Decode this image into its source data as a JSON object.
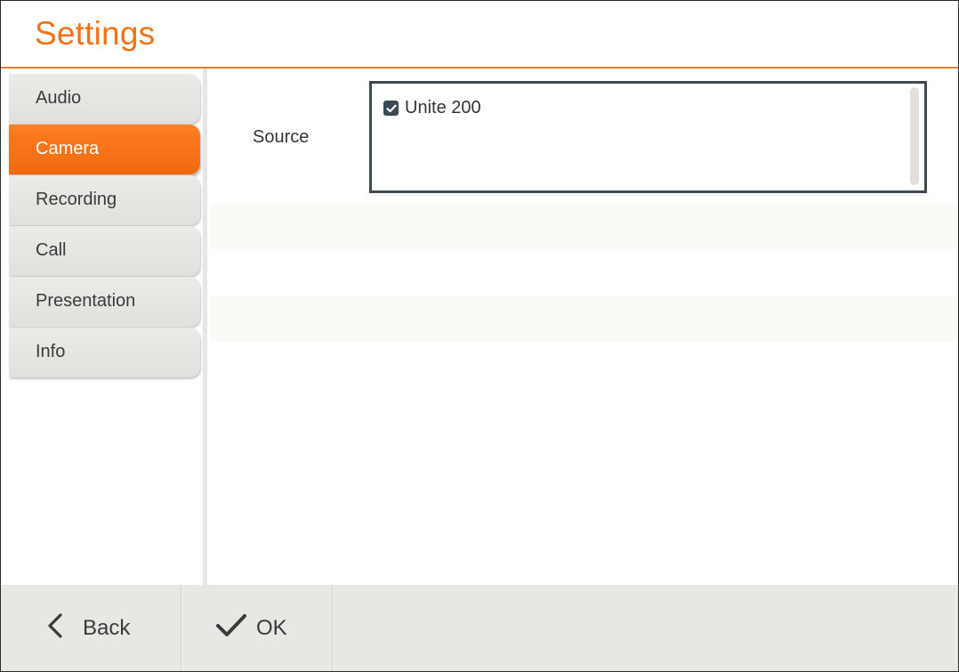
{
  "header": {
    "title": "Settings"
  },
  "sidebar": {
    "items": [
      {
        "label": "Audio",
        "active": false
      },
      {
        "label": "Camera",
        "active": true
      },
      {
        "label": "Recording",
        "active": false
      },
      {
        "label": "Call",
        "active": false
      },
      {
        "label": "Presentation",
        "active": false
      },
      {
        "label": "Info",
        "active": false
      }
    ]
  },
  "main": {
    "source": {
      "label": "Source",
      "options": [
        {
          "label": "Unite 200",
          "checked": true
        }
      ]
    }
  },
  "footer": {
    "back_label": "Back",
    "ok_label": "OK"
  },
  "colors": {
    "accent": "#f07318",
    "active_tab": "#f56f12",
    "border_dark": "#3e4b53"
  },
  "icons": {
    "back": "chevron-left-icon",
    "ok": "checkmark-icon",
    "checkbox": "checkbox-checked-icon"
  }
}
